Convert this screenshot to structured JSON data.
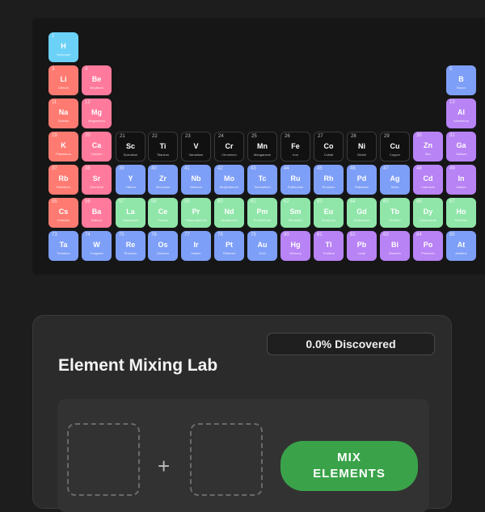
{
  "periodic_table": {
    "elements": [
      {
        "num": "1",
        "sym": "H",
        "name": "Hydrogen",
        "cat": "hydrogen",
        "col": 0,
        "row": 0
      },
      {
        "num": "3",
        "sym": "Li",
        "name": "Lithium",
        "cat": "alkali",
        "col": 0,
        "row": 1
      },
      {
        "num": "4",
        "sym": "Be",
        "name": "Beryllium",
        "cat": "alkaline",
        "col": 1,
        "row": 1
      },
      {
        "num": "5",
        "sym": "B",
        "name": "Boron",
        "cat": "transition",
        "col": 12,
        "row": 1
      },
      {
        "num": "11",
        "sym": "Na",
        "name": "Sodium",
        "cat": "alkali",
        "col": 0,
        "row": 2
      },
      {
        "num": "12",
        "sym": "Mg",
        "name": "Magnesium",
        "cat": "alkaline",
        "col": 1,
        "row": 2
      },
      {
        "num": "13",
        "sym": "Al",
        "name": "Aluminium",
        "cat": "post",
        "col": 12,
        "row": 2
      },
      {
        "num": "19",
        "sym": "K",
        "name": "Potassium",
        "cat": "alkali",
        "col": 0,
        "row": 3
      },
      {
        "num": "20",
        "sym": "Ca",
        "name": "Calcium",
        "cat": "alkaline",
        "col": 1,
        "row": 3
      },
      {
        "num": "21",
        "sym": "Sc",
        "name": "Scandium",
        "cat": "dark",
        "col": 2,
        "row": 3
      },
      {
        "num": "22",
        "sym": "Ti",
        "name": "Titanium",
        "cat": "dark",
        "col": 3,
        "row": 3
      },
      {
        "num": "23",
        "sym": "V",
        "name": "Vanadium",
        "cat": "dark",
        "col": 4,
        "row": 3
      },
      {
        "num": "24",
        "sym": "Cr",
        "name": "Chromium",
        "cat": "dark",
        "col": 5,
        "row": 3
      },
      {
        "num": "25",
        "sym": "Mn",
        "name": "Manganese",
        "cat": "dark",
        "col": 6,
        "row": 3
      },
      {
        "num": "26",
        "sym": "Fe",
        "name": "Iron",
        "cat": "dark",
        "col": 7,
        "row": 3
      },
      {
        "num": "27",
        "sym": "Co",
        "name": "Cobalt",
        "cat": "dark",
        "col": 8,
        "row": 3
      },
      {
        "num": "28",
        "sym": "Ni",
        "name": "Nickel",
        "cat": "dark",
        "col": 9,
        "row": 3
      },
      {
        "num": "29",
        "sym": "Cu",
        "name": "Copper",
        "cat": "dark",
        "col": 10,
        "row": 3
      },
      {
        "num": "30",
        "sym": "Zn",
        "name": "Zinc",
        "cat": "post",
        "col": 11,
        "row": 3
      },
      {
        "num": "31",
        "sym": "Ga",
        "name": "Gallium",
        "cat": "post",
        "col": 12,
        "row": 3
      },
      {
        "num": "37",
        "sym": "Rb",
        "name": "Rubidium",
        "cat": "alkali",
        "col": 0,
        "row": 4
      },
      {
        "num": "38",
        "sym": "Sr",
        "name": "Strontium",
        "cat": "alkaline",
        "col": 1,
        "row": 4
      },
      {
        "num": "39",
        "sym": "Y",
        "name": "Yttrium",
        "cat": "transition",
        "col": 2,
        "row": 4
      },
      {
        "num": "40",
        "sym": "Zr",
        "name": "Zirconium",
        "cat": "transition",
        "col": 3,
        "row": 4
      },
      {
        "num": "41",
        "sym": "Nb",
        "name": "Niobium",
        "cat": "transition",
        "col": 4,
        "row": 4
      },
      {
        "num": "42",
        "sym": "Mo",
        "name": "Molybdenum",
        "cat": "transition",
        "col": 5,
        "row": 4
      },
      {
        "num": "43",
        "sym": "Tc",
        "name": "Technetium",
        "cat": "transition",
        "col": 6,
        "row": 4
      },
      {
        "num": "44",
        "sym": "Ru",
        "name": "Ruthenium",
        "cat": "transition",
        "col": 7,
        "row": 4
      },
      {
        "num": "45",
        "sym": "Rh",
        "name": "Rhodium",
        "cat": "transition",
        "col": 8,
        "row": 4
      },
      {
        "num": "46",
        "sym": "Pd",
        "name": "Palladium",
        "cat": "transition",
        "col": 9,
        "row": 4
      },
      {
        "num": "47",
        "sym": "Ag",
        "name": "Silver",
        "cat": "transition",
        "col": 10,
        "row": 4
      },
      {
        "num": "48",
        "sym": "Cd",
        "name": "Cadmium",
        "cat": "post",
        "col": 11,
        "row": 4
      },
      {
        "num": "49",
        "sym": "In",
        "name": "Indium",
        "cat": "post",
        "col": 12,
        "row": 4
      },
      {
        "num": "55",
        "sym": "Cs",
        "name": "Caesium",
        "cat": "alkali",
        "col": 0,
        "row": 5
      },
      {
        "num": "56",
        "sym": "Ba",
        "name": "Barium",
        "cat": "alkaline",
        "col": 1,
        "row": 5
      },
      {
        "num": "57",
        "sym": "La",
        "name": "Lanthanum",
        "cat": "lanth",
        "col": 2,
        "row": 5
      },
      {
        "num": "58",
        "sym": "Ce",
        "name": "Cerium",
        "cat": "lanth",
        "col": 3,
        "row": 5
      },
      {
        "num": "59",
        "sym": "Pr",
        "name": "Praseodymium",
        "cat": "lanth",
        "col": 4,
        "row": 5
      },
      {
        "num": "60",
        "sym": "Nd",
        "name": "Neodymium",
        "cat": "lanth",
        "col": 5,
        "row": 5
      },
      {
        "num": "61",
        "sym": "Pm",
        "name": "Promethium",
        "cat": "lanth",
        "col": 6,
        "row": 5
      },
      {
        "num": "62",
        "sym": "Sm",
        "name": "Samarium",
        "cat": "lanth",
        "col": 7,
        "row": 5
      },
      {
        "num": "63",
        "sym": "Eu",
        "name": "Europium",
        "cat": "lanth",
        "col": 8,
        "row": 5
      },
      {
        "num": "64",
        "sym": "Gd",
        "name": "Gadolinium",
        "cat": "lanth",
        "col": 9,
        "row": 5
      },
      {
        "num": "65",
        "sym": "Tb",
        "name": "Terbium",
        "cat": "lanth",
        "col": 10,
        "row": 5
      },
      {
        "num": "66",
        "sym": "Dy",
        "name": "Dysprosium",
        "cat": "lanth",
        "col": 11,
        "row": 5
      },
      {
        "num": "67",
        "sym": "Ho",
        "name": "Holmium",
        "cat": "lanth",
        "col": 12,
        "row": 5
      },
      {
        "num": "73",
        "sym": "Ta",
        "name": "Tantalum",
        "cat": "transition",
        "col": 0,
        "row": 6
      },
      {
        "num": "74",
        "sym": "W",
        "name": "Tungsten",
        "cat": "transition",
        "col": 1,
        "row": 6
      },
      {
        "num": "75",
        "sym": "Re",
        "name": "Rhenium",
        "cat": "transition",
        "col": 2,
        "row": 6
      },
      {
        "num": "76",
        "sym": "Os",
        "name": "Osmium",
        "cat": "transition",
        "col": 3,
        "row": 6
      },
      {
        "num": "77",
        "sym": "Ir",
        "name": "Iridium",
        "cat": "transition",
        "col": 4,
        "row": 6
      },
      {
        "num": "78",
        "sym": "Pt",
        "name": "Platinum",
        "cat": "transition",
        "col": 5,
        "row": 6
      },
      {
        "num": "79",
        "sym": "Au",
        "name": "Gold",
        "cat": "transition",
        "col": 6,
        "row": 6
      },
      {
        "num": "80",
        "sym": "Hg",
        "name": "Mercury",
        "cat": "post",
        "col": 7,
        "row": 6
      },
      {
        "num": "81",
        "sym": "Tl",
        "name": "Thallium",
        "cat": "post",
        "col": 8,
        "row": 6
      },
      {
        "num": "82",
        "sym": "Pb",
        "name": "Lead",
        "cat": "post",
        "col": 9,
        "row": 6
      },
      {
        "num": "83",
        "sym": "Bi",
        "name": "Bismuth",
        "cat": "post",
        "col": 10,
        "row": 6
      },
      {
        "num": "84",
        "sym": "Po",
        "name": "Polonium",
        "cat": "post",
        "col": 11,
        "row": 6
      },
      {
        "num": "85",
        "sym": "At",
        "name": "Astatine",
        "cat": "transition",
        "col": 12,
        "row": 6
      }
    ]
  },
  "lab": {
    "title": "Element Mixing Lab",
    "discovered": "0.0% Discovered",
    "plus": "+",
    "mix_line1": "MIX",
    "mix_line2": "ELEMENTS"
  },
  "colors": {
    "alkali": "#ff7b72",
    "alkaline": "#ff7a9c",
    "hydrogen": "#6bd1f7",
    "transition": "#7e9ff7",
    "lanthanide": "#8fe6a8",
    "post_transition": "#b883f5",
    "button": "#3aa34a"
  }
}
